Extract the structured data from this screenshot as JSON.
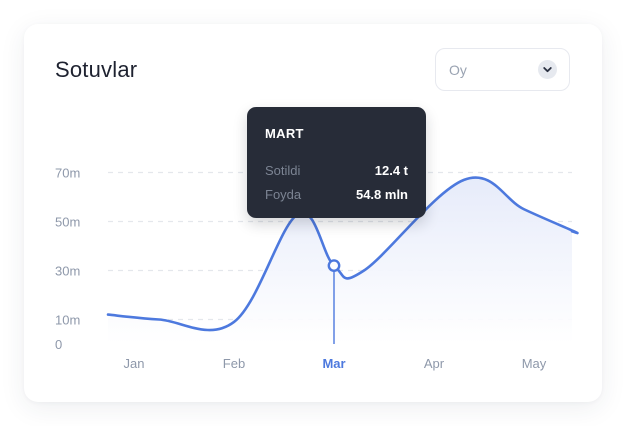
{
  "card": {
    "title": "Sotuvlar"
  },
  "period_select": {
    "value": "Oy"
  },
  "tooltip": {
    "title": "MART",
    "rows": [
      {
        "label": "Sotildi",
        "value": "12.4 t"
      },
      {
        "label": "Foyda",
        "value": "54.8 mln"
      }
    ]
  },
  "colors": {
    "line": "#4d79de",
    "area_top": "#e6ebfa",
    "tooltip_bg": "#272c38",
    "axis_text": "#8e98aa",
    "active_axis_text": "#4d79de",
    "grid": "#e4e7ec"
  },
  "chart_data": {
    "type": "area",
    "y_ticks": [
      "0",
      "10m",
      "30m",
      "50m",
      "70m"
    ],
    "y_tick_values": [
      0,
      10,
      30,
      50,
      70
    ],
    "x_ticks": [
      "Jan",
      "Feb",
      "Mar",
      "Apr",
      "May"
    ],
    "active_x": "Mar",
    "ylim": [
      0,
      80
    ],
    "grid": true,
    "series": [
      {
        "x": [
          0.25,
          1.0,
          1.64,
          2.0,
          2.3,
          3.3,
          3.9,
          4.4
        ],
        "values": [
          10,
          9,
          53,
          32,
          30,
          67,
          55,
          46
        ]
      }
    ]
  }
}
